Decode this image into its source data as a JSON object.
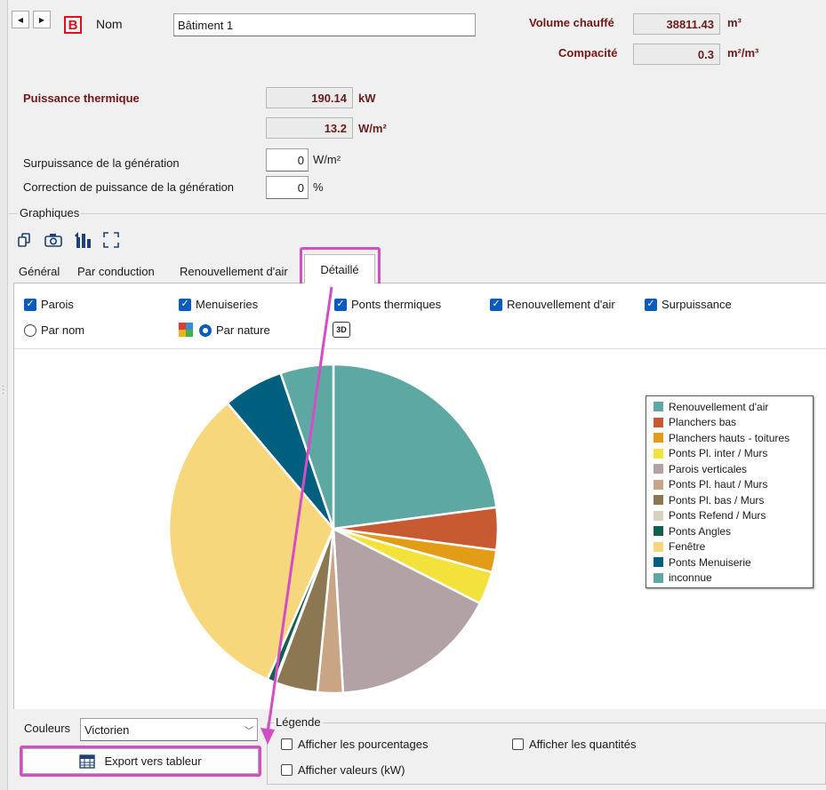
{
  "header": {
    "nom_label": "Nom",
    "nom_value": "Bâtiment 1",
    "volume_label": "Volume chauffé",
    "volume_value": "38811.43",
    "volume_unit": "m³",
    "compacite_label": "Compacité",
    "compacite_value": "0.3",
    "compacite_unit": "m²/m³"
  },
  "thermal": {
    "puissance_label": "Puissance thermique",
    "puissance_kw": "190.14",
    "puissance_kw_unit": "kW",
    "puissance_wm2": "13.2",
    "puissance_wm2_unit": "W/m²",
    "surpuissance_label": "Surpuissance de la génération",
    "surpuissance_value": "0",
    "surpuissance_unit": "W/m²",
    "correction_label": "Correction de puissance de la génération",
    "correction_value": "0",
    "correction_unit": "%"
  },
  "graphiques": {
    "group_label": "Graphiques",
    "tabs": [
      {
        "label": "Général"
      },
      {
        "label": "Par conduction"
      },
      {
        "label": "Renouvellement d'air"
      },
      {
        "label": "Détaillé"
      }
    ],
    "active_tab": 3,
    "checkboxes": {
      "parois": "Parois",
      "menuiseries": "Menuiseries",
      "ponts": "Ponts thermiques",
      "renouvellement": "Renouvellement d'air",
      "surpuissance": "Surpuissance"
    },
    "radio_par_nom": "Par nom",
    "radio_par_nature": "Par nature",
    "btn_3d": "3D"
  },
  "chart_data": {
    "type": "pie",
    "legend_position": "right",
    "series": [
      {
        "name": "Renouvellement d'air",
        "value": 22.0,
        "color": "#5ea8a3"
      },
      {
        "name": "Planchers bas",
        "value": 4.0,
        "color": "#c85a32"
      },
      {
        "name": "Planchers hauts - toitures",
        "value": 2.1,
        "color": "#e39c16"
      },
      {
        "name": "Ponts Pl. inter / Murs",
        "value": 3.1,
        "color": "#f4e23c"
      },
      {
        "name": "Parois verticales",
        "value": 15.9,
        "color": "#b3a2a5"
      },
      {
        "name": "Ponts Pl. haut / Murs",
        "value": 2.4,
        "color": "#c9a585"
      },
      {
        "name": "Ponts Pl. bas / Murs",
        "value": 4.0,
        "color": "#8b7752"
      },
      {
        "name": "Ponts Refend / Murs",
        "value": 0.1,
        "color": "#d8d1bf"
      },
      {
        "name": "Ponts Angles",
        "value": 0.7,
        "color": "#115f4c"
      },
      {
        "name": "Fenêtre",
        "value": 31.0,
        "color": "#f7d77b"
      },
      {
        "name": "Ponts Menuiserie",
        "value": 5.7,
        "color": "#005e7f"
      },
      {
        "name": "inconnue",
        "value": 5.0,
        "color": "#5ea8a3"
      }
    ]
  },
  "bottom": {
    "couleurs_label": "Couleurs",
    "couleurs_value": "Victorien",
    "export_label": "Export vers tableur",
    "legende_label": "Légende",
    "afficher_pourcentages": "Afficher les pourcentages",
    "afficher_quantites": "Afficher les quantités",
    "afficher_valeurs": "Afficher valeurs (kW)"
  },
  "colors": {
    "accent": "#0a5bbf",
    "highlight": "#d34ec6",
    "label_red": "#7a1515"
  }
}
